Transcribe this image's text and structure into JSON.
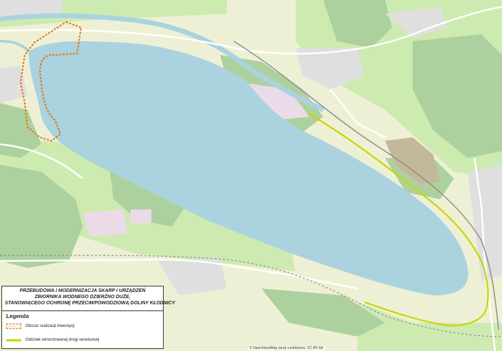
{
  "map": {
    "colors": {
      "land": "#f2efe9",
      "farmland": "#eef0d5",
      "grass": "#cdebb0",
      "forest": "#add19e",
      "water": "#aad3df",
      "residential": "#e0dfdf",
      "industrial": "#ebdbe8",
      "bare": "#c4b89a",
      "road": "#ffffff",
      "railway": "#8c8c8c",
      "investment_area": "#e07a1c",
      "service_road": "#c8d400"
    }
  },
  "legend": {
    "title_lines": [
      "PRZEBUDOWA I MODERNIZACJA SKARP I URZĄDZEŃ",
      "ZBIORNIKA WODNEGO DZIERŻNO DUŻE,",
      "STANOWIĄCEGO OCHRONĘ PRZECIWPOWODZIOWĄ DOLINY KŁODNICY"
    ],
    "heading": "Legenda",
    "items": [
      {
        "label": "Obszar realizacji inwestycji",
        "symbol": "dashed-orange-area"
      },
      {
        "label": "Odcinek remontowanej drogi serwisowej",
        "symbol": "yellow-line"
      }
    ]
  },
  "attribution": "© OpenStreetMap (and) contributors, CC-BY-SA"
}
